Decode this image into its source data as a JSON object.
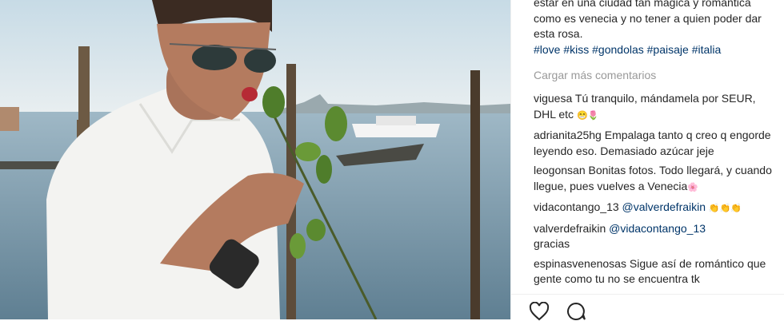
{
  "caption": {
    "text": "estar en una ciudad tan mágica y romantica como es venecia y no tener a quien poder dar esta rosa.",
    "hashtags": "#love #kiss #gondolas #paisaje #italia"
  },
  "load_more_label": "Cargar más comentarios",
  "comments": [
    {
      "user": "viguesa",
      "text": "Tú tranquilo, mándamela por SEUR, DHL etc",
      "emoji": "😁🌷"
    },
    {
      "user": "adrianita25hg",
      "text": "Empalaga tanto q creo q engorde leyendo eso. Demasiado azúcar jeje",
      "emoji": ""
    },
    {
      "user": "leogonsan",
      "text": "Bonitas fotos. Todo llegará, y cuando llegue, pues vuelves a Venecia",
      "emoji": "🌸"
    },
    {
      "user": "vidacontango_13",
      "mention": "@valverdefraikin",
      "emoji": "👏👏👏"
    },
    {
      "user": "valverdefraikin",
      "mention": "@vidacontango_13",
      "text": "gracias",
      "emoji": ""
    },
    {
      "user": "espinasvenenosas",
      "text": "Sigue así de romántico que gente como tu no se encuentra tk",
      "emoji": ""
    }
  ],
  "colors": {
    "link": "#003569",
    "muted": "#999999",
    "text": "#262626",
    "sky": "#cfe0ea",
    "water": "#7f9fb3"
  },
  "icons": {
    "like": "heart-icon",
    "comment": "speech-bubble-icon"
  }
}
